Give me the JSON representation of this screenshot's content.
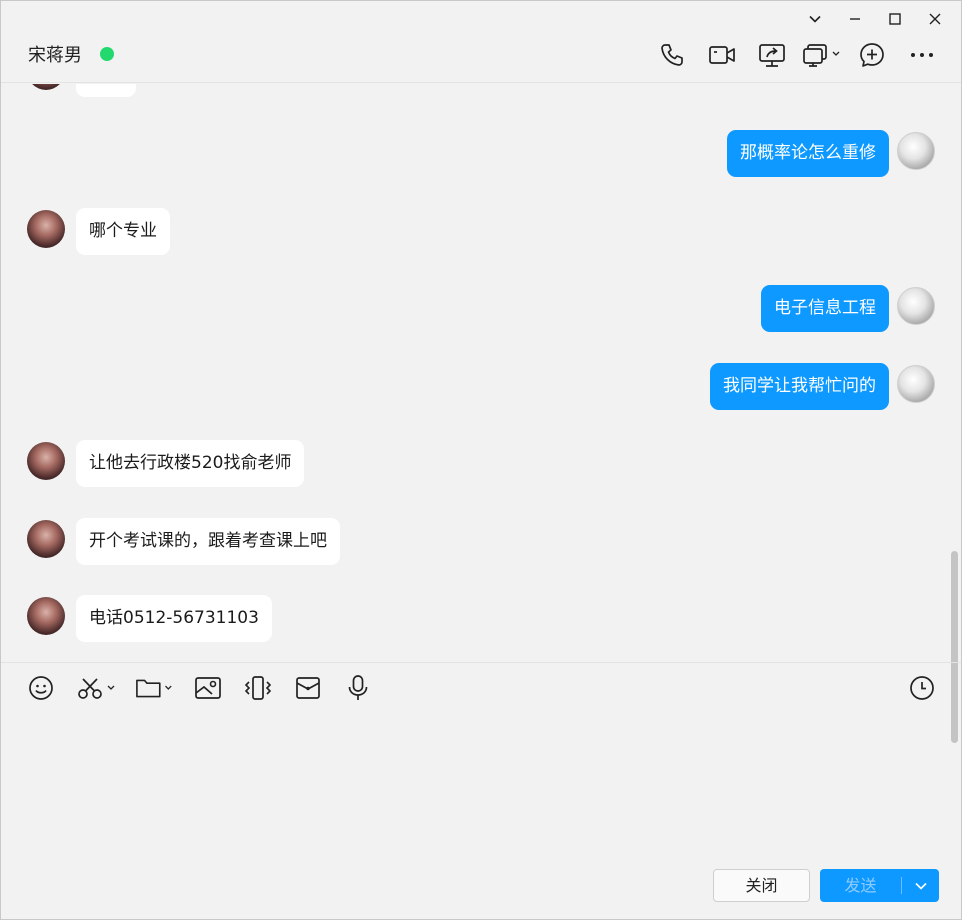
{
  "window": {
    "controls": {
      "collapse_icon": "chevron-down-icon",
      "minimize_icon": "minimize-icon",
      "maximize_icon": "maximize-icon",
      "close_icon": "close-icon"
    }
  },
  "header": {
    "contact_name": "宋蒋男",
    "status_color": "#23d96e",
    "tools": [
      "phone-icon",
      "video-call-icon",
      "screen-share-icon",
      "remote-assist-icon",
      "add-chat-icon",
      "more-icon"
    ]
  },
  "messages": [
    {
      "side": "right",
      "text": "那概率论怎么重修"
    },
    {
      "side": "left",
      "text": "哪个专业"
    },
    {
      "side": "right",
      "text": "电子信息工程"
    },
    {
      "side": "right",
      "text": "我同学让我帮忙问的"
    },
    {
      "side": "left",
      "text": "让他去行政楼520找俞老师"
    },
    {
      "side": "left",
      "text": "开个考试课的，跟着考查课上吧"
    },
    {
      "side": "left",
      "text": "电话0512-56731103"
    }
  ],
  "toolbar": {
    "tools": [
      "emoji-icon",
      "screenshot-icon",
      "file-icon",
      "image-icon",
      "shake-icon",
      "red-packet-icon",
      "microphone-icon"
    ],
    "history_icon": "clock-icon"
  },
  "actions": {
    "close_label": "关闭",
    "send_label": "发送"
  },
  "colors": {
    "accent": "#0d99ff",
    "bubble_incoming": "#ffffff",
    "background": "#f2f2f2"
  }
}
